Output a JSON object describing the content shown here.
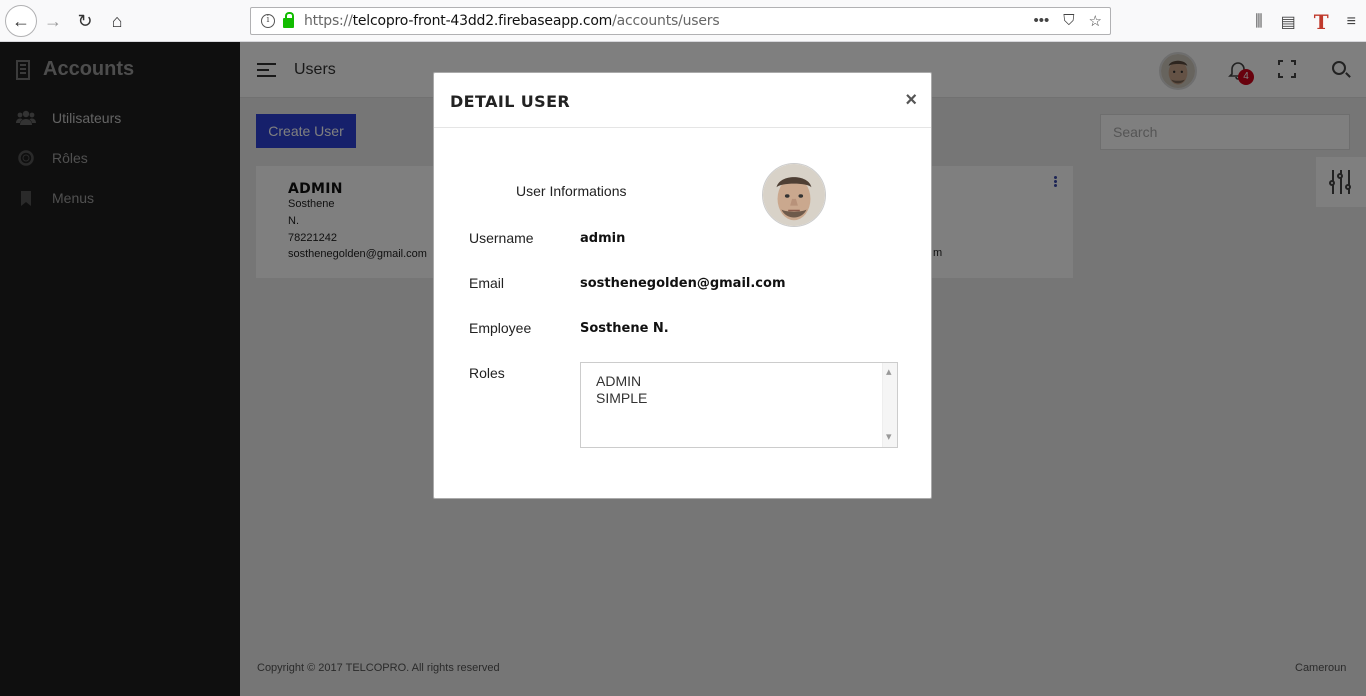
{
  "browser": {
    "url_prefix": "https://",
    "url_host": "telcopro-front-43dd2.firebaseapp.com",
    "url_path": "/accounts/users",
    "page_actions_icon": "•••"
  },
  "sidebar": {
    "title": "Accounts",
    "items": [
      {
        "label": "Utilisateurs",
        "icon": "users-icon"
      },
      {
        "label": "Rôles",
        "icon": "life-ring-icon"
      },
      {
        "label": "Menus",
        "icon": "bookmark-icon"
      }
    ]
  },
  "header": {
    "title": "Users",
    "notification_count": "4"
  },
  "toolbar": {
    "create_label": "Create User",
    "search_placeholder": "Search"
  },
  "user_card": {
    "username": "ADMIN",
    "first_name": "Sosthene",
    "last_name": "N.",
    "phone": "78221242",
    "email": "sosthenegolden@gmail.com",
    "right_fragment": "m"
  },
  "footer": {
    "copyright": "Copyright © 2017 TELCOPRO. All rights reserved",
    "country": "Cameroun"
  },
  "modal": {
    "title": "DETAIL USER",
    "close": "×",
    "section_title": "User Informations",
    "fields": {
      "username_label": "Username",
      "username_value": "admin",
      "email_label": "Email",
      "email_value": "sosthenegolden@gmail.com",
      "employee_label": "Employee",
      "employee_value": "Sosthene N.",
      "roles_label": "Roles"
    },
    "roles": [
      "ADMIN",
      "SIMPLE"
    ]
  },
  "colors": {
    "primary": "#2c41d6",
    "sidebar_bg": "#1f1f1f",
    "badge": "#d0021b"
  }
}
